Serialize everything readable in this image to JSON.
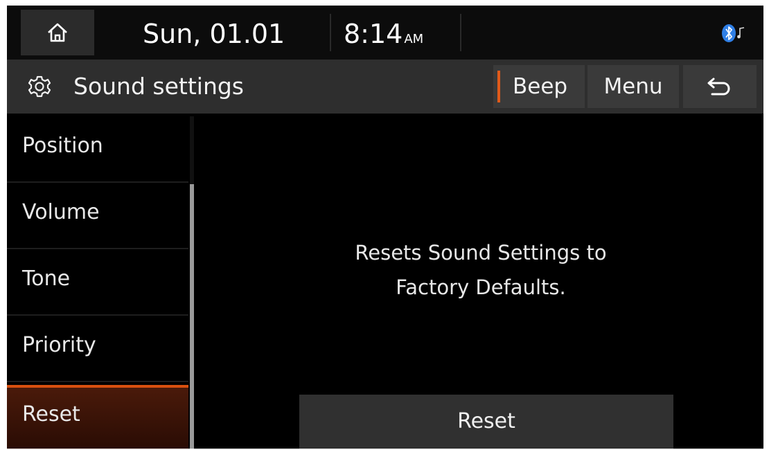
{
  "status_bar": {
    "home_icon": "home-icon",
    "date": "Sun, 01.01",
    "time": "8:14",
    "ampm": "AM",
    "bluetooth_icon": "bluetooth-audio-icon"
  },
  "title_bar": {
    "icon": "gear-icon",
    "title": "Sound settings",
    "beep_label": "Beep",
    "menu_label": "Menu",
    "back_icon": "back-arrow-icon",
    "accent_color": "#e05a1a"
  },
  "sidebar": {
    "items": [
      {
        "label": "Position"
      },
      {
        "label": "Volume"
      },
      {
        "label": "Tone"
      },
      {
        "label": "Priority"
      },
      {
        "label": "Reset"
      }
    ],
    "selected": "Reset"
  },
  "content": {
    "message_line1": "Resets Sound Settings to",
    "message_line2": "Factory Defaults.",
    "reset_button_label": "Reset"
  }
}
